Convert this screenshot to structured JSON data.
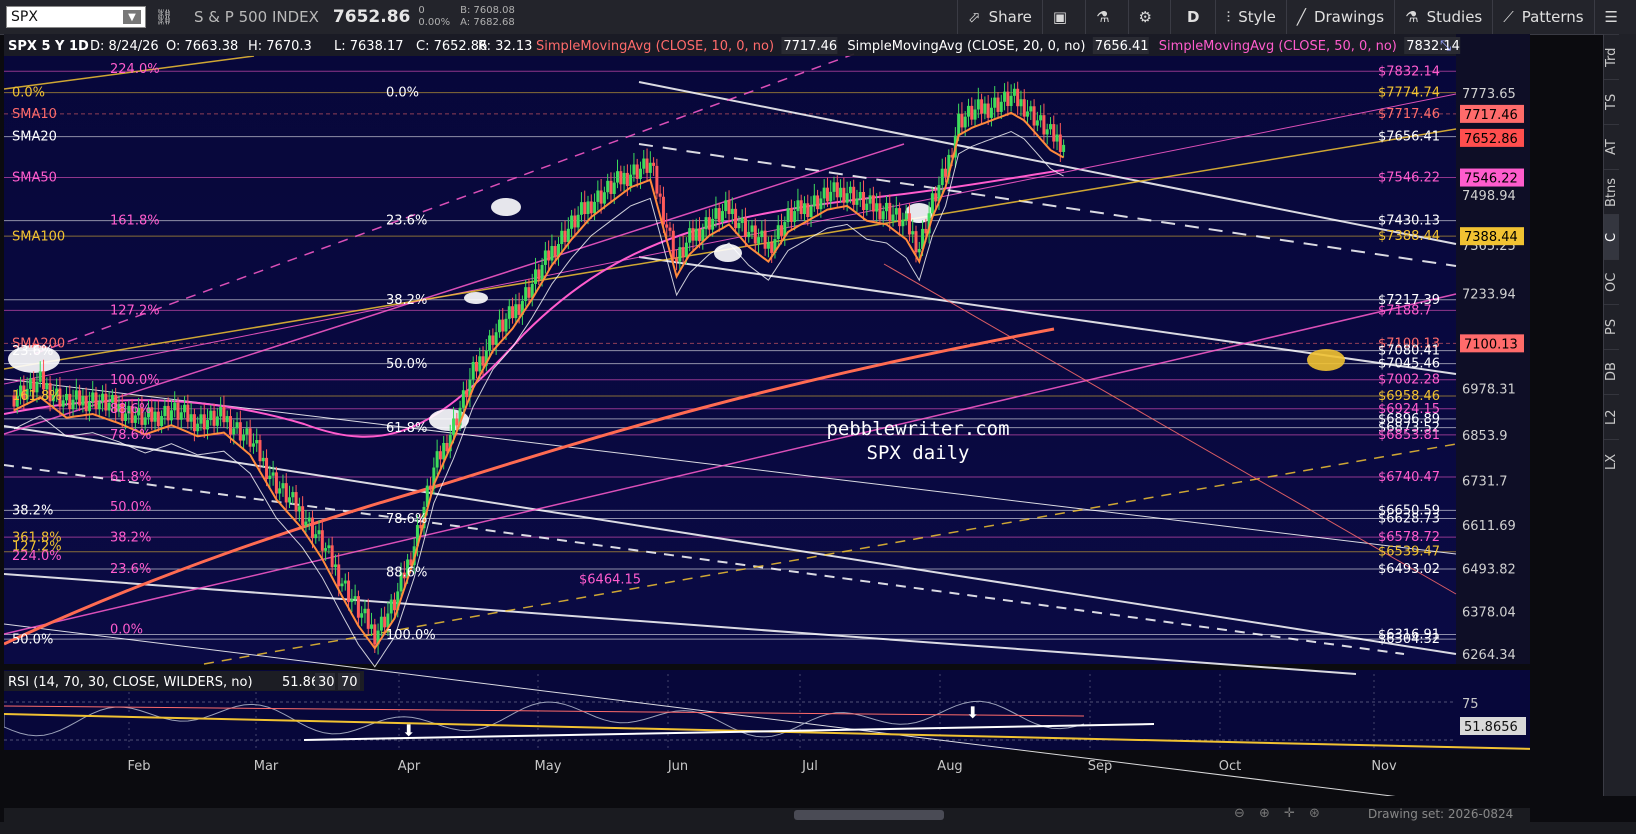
{
  "toolbar": {
    "symbol": "SPX",
    "description": "S & P 500 INDEX",
    "last": "7652.86",
    "change": "0",
    "change_pct": "0.00%",
    "bid": "B: 7608.08",
    "ask": "A: 7682.68",
    "buttons": {
      "share": "Share",
      "aggregation": "D",
      "style": "Style",
      "drawings": "Drawings",
      "studies": "Studies",
      "patterns": "Patterns"
    }
  },
  "header": {
    "title": "SPX 5 Y 1D",
    "date": "D: 8/24/26",
    "open": "O: 7663.38",
    "high": "H: 7670.3",
    "low": "L: 7638.17",
    "close": "C: 7652.86",
    "range": "R: 32.13",
    "studies": [
      {
        "label": "SimpleMovingAvg (CLOSE, 10, 0, no)",
        "value": "7717.46",
        "color": "#ff6b6b"
      },
      {
        "label": "SimpleMovingAvg (CLOSE, 20, 0, no)",
        "value": "7656.41",
        "color": "#ffffff"
      },
      {
        "label": "SimpleMovingAvg (CLOSE, 50, 0, no)",
        "value": "7832.14",
        "color": "#ff5ccd"
      }
    ]
  },
  "watermark": {
    "line1": "pebblewriter.com",
    "line2": "SPX daily"
  },
  "side_tabs": [
    "Trd",
    "TS",
    "AT",
    "Btns",
    "C",
    "OC",
    "PS",
    "DB",
    "L2",
    "LX"
  ],
  "active_side_tab": "C",
  "rsi": {
    "label": "RSI (14, 70, 30, CLOSE, WILDERS, no)",
    "value": "51.8656",
    "lower": "30",
    "upper": "70",
    "axis_label": "75",
    "current": "51.8656"
  },
  "drawing_set": "Drawing set: 2026-0824",
  "chart_data": {
    "type": "candlestick",
    "x_ticks": [
      "Feb",
      "Mar",
      "Apr",
      "May",
      "Jun",
      "Jul",
      "Aug",
      "Sep",
      "Oct",
      "Nov"
    ],
    "y_ticks": [
      "7773.65",
      "7653.08",
      "7498.94",
      "7365.25",
      "7233.94",
      "6978.31",
      "6853.9",
      "6731.7",
      "6611.69",
      "6493.82",
      "6378.04",
      "6264.34"
    ],
    "ylim": [
      6210,
      7890
    ],
    "price_boxes": [
      {
        "text": "7717.46",
        "value": 7717.46,
        "color": "#ff6b6b"
      },
      {
        "text": "7652.86",
        "value": 7652.86,
        "color": "#ff4e4e"
      },
      {
        "text": "7546.22",
        "value": 7546.22,
        "color": "#ff5ccd"
      },
      {
        "text": "7388.44",
        "value": 7388.44,
        "color": "#f1c232"
      },
      {
        "text": "7100.13",
        "value": 7100.13,
        "color": "#ff6b6b"
      }
    ],
    "right_levels": [
      {
        "text": "7832.14",
        "value": 7832.14,
        "color": "#ff5ccd"
      },
      {
        "text": "7774.74",
        "value": 7774.74,
        "color": "#f1c232"
      },
      {
        "text": "7717.46",
        "value": 7717.46,
        "color": "#ff6b6b"
      },
      {
        "text": "7656.41",
        "value": 7656.41,
        "color": "#ffffff"
      },
      {
        "text": "7546.22",
        "value": 7546.22,
        "color": "#ff5ccd"
      },
      {
        "text": "7430.13",
        "value": 7430.13,
        "color": "#ffffff"
      },
      {
        "text": "7388.44",
        "value": 7388.44,
        "color": "#f1c232"
      },
      {
        "text": "7217.39",
        "value": 7217.39,
        "color": "#ffffff"
      },
      {
        "text": "7188.7",
        "value": 7188.7,
        "color": "#ff5ccd"
      },
      {
        "text": "7100.13",
        "value": 7100.13,
        "color": "#ff6b6b"
      },
      {
        "text": "7080.41",
        "value": 7080.41,
        "color": "#ffffff"
      },
      {
        "text": "7045.46",
        "value": 7045.46,
        "color": "#ffffff"
      },
      {
        "text": "7002.28",
        "value": 7002.28,
        "color": "#ff5ccd"
      },
      {
        "text": "6958.46",
        "value": 6958.46,
        "color": "#f1c232"
      },
      {
        "text": "6924.15",
        "value": 6924.15,
        "color": "#ff5ccd"
      },
      {
        "text": "6896.89",
        "value": 6896.89,
        "color": "#ffffff"
      },
      {
        "text": "6873.52",
        "value": 6873.52,
        "color": "#ffffff"
      },
      {
        "text": "6853.81",
        "value": 6853.81,
        "color": "#ff5ccd"
      },
      {
        "text": "6740.47",
        "value": 6740.47,
        "color": "#ff5ccd"
      },
      {
        "text": "6650.59",
        "value": 6650.59,
        "color": "#ffffff"
      },
      {
        "text": "6628.73",
        "value": 6628.73,
        "color": "#ffffff"
      },
      {
        "text": "6578.72",
        "value": 6578.72,
        "color": "#ff5ccd"
      },
      {
        "text": "6539.47",
        "value": 6539.47,
        "color": "#f1c232"
      },
      {
        "text": "6493.02",
        "value": 6493.02,
        "color": "#ffffff"
      },
      {
        "text": "6316.91",
        "value": 6316.91,
        "color": "#ffffff"
      },
      {
        "text": "6304.32",
        "value": 6304.32,
        "color": "#ffffff"
      }
    ],
    "left_labels": [
      {
        "text": "0.0%",
        "value": 7775,
        "color": "#f1c232",
        "col": 0
      },
      {
        "text": "SMA10",
        "value": 7717,
        "color": "#ff6b6b",
        "col": 0
      },
      {
        "text": "SMA20",
        "value": 7656,
        "color": "#ffffff",
        "col": 0
      },
      {
        "text": "SMA50",
        "value": 7546,
        "color": "#ff5ccd",
        "col": 0
      },
      {
        "text": "SMA100",
        "value": 7388,
        "color": "#f1c232",
        "col": 0
      },
      {
        "text": "SMA200",
        "value": 7100,
        "color": "#ff6b6b",
        "col": 0
      },
      {
        "text": "23.6%",
        "value": 7080,
        "color": "#ffffff",
        "col": 0
      },
      {
        "text": "161.8%",
        "value": 6958,
        "color": "#f1c232",
        "col": 0
      },
      {
        "text": "38.2%",
        "value": 6650,
        "color": "#ffffff",
        "col": 0
      },
      {
        "text": "361.8%",
        "value": 6578,
        "color": "#f1c232",
        "col": 0
      },
      {
        "text": "127.2%",
        "value": 6553,
        "color": "#f1c232",
        "col": 0
      },
      {
        "text": "224.0%",
        "value": 6528,
        "color": "#ff5ccd",
        "col": 0
      },
      {
        "text": "50.0%",
        "value": 6304,
        "color": "#ffffff",
        "col": 0
      },
      {
        "text": "224.0%",
        "value": 7838,
        "color": "#ff5ccd",
        "col": 1
      },
      {
        "text": "161.8%",
        "value": 7430,
        "color": "#ff5ccd",
        "col": 1
      },
      {
        "text": "127.2%",
        "value": 7188,
        "color": "#ff5ccd",
        "col": 1
      },
      {
        "text": "100.0%",
        "value": 7002,
        "color": "#ff5ccd",
        "col": 1
      },
      {
        "text": "88.6%",
        "value": 6924,
        "color": "#ff5ccd",
        "col": 1
      },
      {
        "text": "78.6%",
        "value": 6853,
        "color": "#ff5ccd",
        "col": 1
      },
      {
        "text": "61.8%",
        "value": 6740,
        "color": "#ff5ccd",
        "col": 1
      },
      {
        "text": "50.0%",
        "value": 6660,
        "color": "#ff5ccd",
        "col": 1
      },
      {
        "text": "38.2%",
        "value": 6578,
        "color": "#ff5ccd",
        "col": 1
      },
      {
        "text": "23.6%",
        "value": 6493,
        "color": "#ff5ccd",
        "col": 1
      },
      {
        "text": "0.0%",
        "value": 6330,
        "color": "#ff5ccd",
        "col": 1
      },
      {
        "text": "0.0%",
        "value": 7775,
        "color": "#ffffff",
        "col": 2
      },
      {
        "text": "23.6%",
        "value": 7430,
        "color": "#ffffff",
        "col": 2
      },
      {
        "text": "38.2%",
        "value": 7217,
        "color": "#ffffff",
        "col": 2
      },
      {
        "text": "50.0%",
        "value": 7045,
        "color": "#ffffff",
        "col": 2
      },
      {
        "text": "61.8%",
        "value": 6873,
        "color": "#ffffff",
        "col": 2
      },
      {
        "text": "78.6%",
        "value": 6628,
        "color": "#ffffff",
        "col": 2
      },
      {
        "text": "88.6%",
        "value": 6483,
        "color": "#ffffff",
        "col": 2
      },
      {
        "text": "100.0%",
        "value": 6316,
        "color": "#ffffff",
        "col": 2
      }
    ],
    "mid_label": {
      "text": "$6464.15",
      "value": 6464.15,
      "color": "#ff5ccd"
    },
    "close_path": [
      [
        0,
        6960
      ],
      [
        8,
        6995
      ],
      [
        16,
        6940
      ],
      [
        24,
        6950
      ],
      [
        32,
        6925
      ],
      [
        40,
        6895
      ],
      [
        48,
        6920
      ],
      [
        56,
        6890
      ],
      [
        64,
        6900
      ],
      [
        72,
        6840
      ],
      [
        80,
        6720
      ],
      [
        88,
        6640
      ],
      [
        94,
        6560
      ],
      [
        100,
        6460
      ],
      [
        105,
        6380
      ],
      [
        110,
        6320
      ],
      [
        116,
        6400
      ],
      [
        122,
        6560
      ],
      [
        128,
        6760
      ],
      [
        134,
        6880
      ],
      [
        140,
        7020
      ],
      [
        146,
        7120
      ],
      [
        152,
        7180
      ],
      [
        158,
        7260
      ],
      [
        164,
        7350
      ],
      [
        170,
        7420
      ],
      [
        176,
        7480
      ],
      [
        182,
        7520
      ],
      [
        188,
        7560
      ],
      [
        194,
        7580
      ],
      [
        198,
        7450
      ],
      [
        202,
        7320
      ],
      [
        206,
        7380
      ],
      [
        212,
        7430
      ],
      [
        218,
        7460
      ],
      [
        224,
        7400
      ],
      [
        230,
        7360
      ],
      [
        236,
        7440
      ],
      [
        242,
        7470
      ],
      [
        248,
        7500
      ],
      [
        254,
        7510
      ],
      [
        260,
        7470
      ],
      [
        266,
        7460
      ],
      [
        272,
        7420
      ],
      [
        276,
        7360
      ],
      [
        280,
        7480
      ],
      [
        284,
        7560
      ],
      [
        288,
        7700
      ],
      [
        292,
        7720
      ],
      [
        298,
        7740
      ],
      [
        304,
        7760
      ],
      [
        308,
        7740
      ],
      [
        312,
        7700
      ],
      [
        316,
        7660
      ],
      [
        320,
        7640
      ]
    ]
  }
}
